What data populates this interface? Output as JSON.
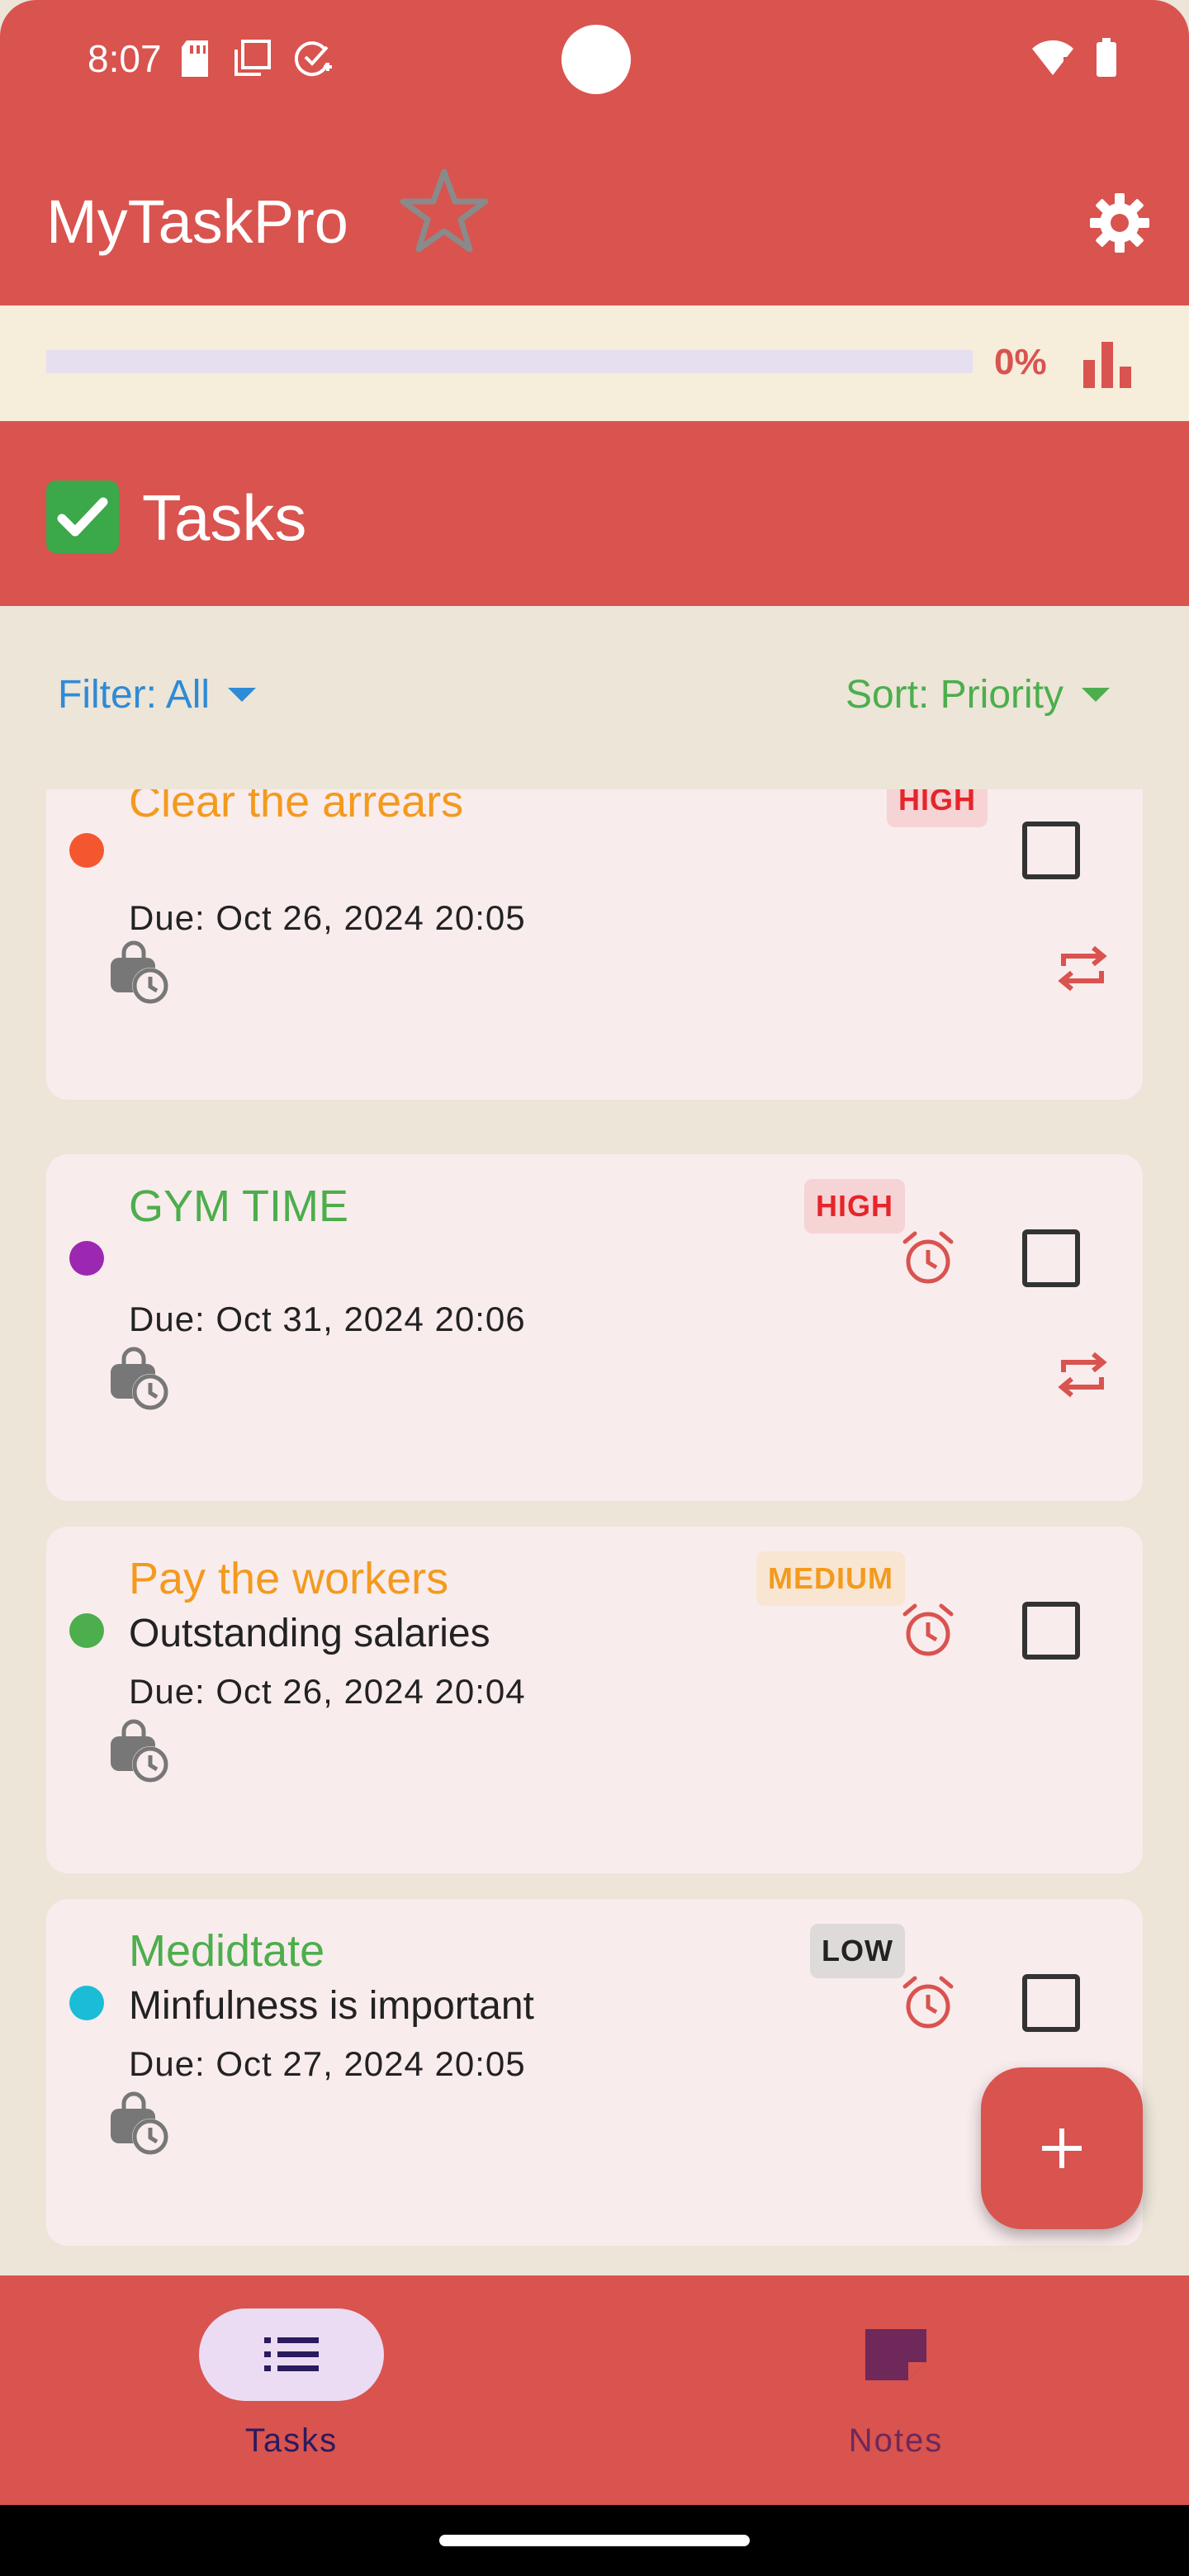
{
  "status_bar": {
    "time": "8:07",
    "left_icons": [
      "sd-card-icon",
      "copy-icon",
      "task-check-icon"
    ],
    "right_icons": [
      "wifi-icon",
      "battery-icon"
    ]
  },
  "app_bar": {
    "title": "MyTaskPro",
    "actions": [
      "star-icon",
      "gear-icon"
    ]
  },
  "progress": {
    "percent_label": "0%",
    "value": 0
  },
  "section": {
    "emoji": "✅",
    "title": "Tasks"
  },
  "controls": {
    "filter_label": "Filter: All",
    "sort_label": "Sort: Priority"
  },
  "tasks": [
    {
      "title": "Clear the arrears",
      "title_color": "#f39a1e",
      "dot_color": "#f4572f",
      "priority": "HIGH",
      "description": "",
      "due": "Due: Oct 26, 2024 20:05",
      "has_alarm": false,
      "has_repeat": true,
      "checked": false
    },
    {
      "title": "GYM TIME",
      "title_color": "#4cae4c",
      "dot_color": "#9c27b0",
      "priority": "HIGH",
      "description": "",
      "due": "Due: Oct 31, 2024 20:06",
      "has_alarm": true,
      "has_repeat": true,
      "checked": false
    },
    {
      "title": "Pay the workers",
      "title_color": "#f39a1e",
      "dot_color": "#4cae4c",
      "priority": "MEDIUM",
      "description": "Outstanding salaries",
      "due": "Due: Oct 26, 2024 20:04",
      "has_alarm": true,
      "has_repeat": false,
      "checked": false
    },
    {
      "title": "Medidtate",
      "title_color": "#4cae4c",
      "dot_color": "#1bbcd6",
      "priority": "LOW",
      "description": "Minfulness is important",
      "due": "Due: Oct 27, 2024 20:05",
      "has_alarm": true,
      "has_repeat": false,
      "checked": false
    }
  ],
  "priority_colors": {
    "HIGH": {
      "text": "#e5252a",
      "bg": "#f6d3d5"
    },
    "MEDIUM": {
      "text": "#f39a1e",
      "bg": "#f8e6d2"
    },
    "LOW": {
      "text": "#222222",
      "bg": "#dedad9"
    }
  },
  "fab": {
    "icon": "plus-icon"
  },
  "bottom_nav": {
    "items": [
      {
        "label": "Tasks",
        "icon": "list-icon",
        "selected": true
      },
      {
        "label": "Notes",
        "icon": "note-icon",
        "selected": false
      }
    ]
  },
  "colors": {
    "accent": "#d9534f",
    "background": "#ece5d8",
    "card": "#f9eced"
  }
}
